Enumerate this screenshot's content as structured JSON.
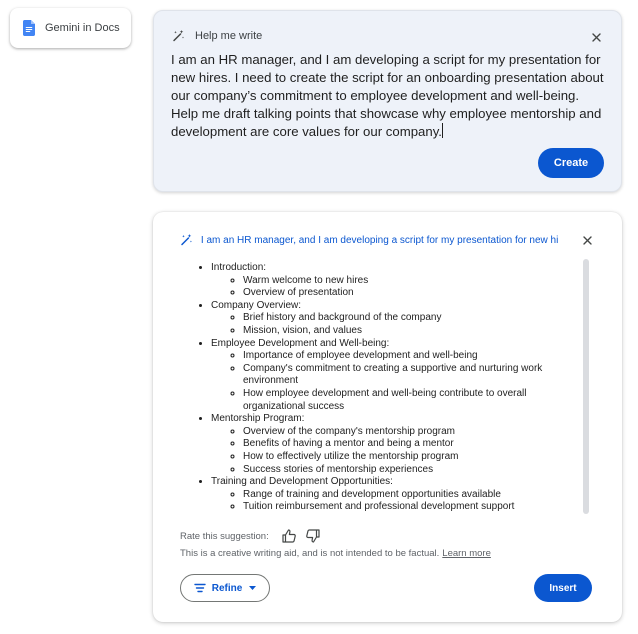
{
  "chip": {
    "icon": "google-docs-icon",
    "label": "Gemini in Docs"
  },
  "help_me_write": {
    "title": "Help me write",
    "prompt": "I am an HR manager, and I am developing a script for my presentation for new hires. I need to create the script for an onboarding presentation about our company’s commitment to employee development and well-being. Help me draft talking points that showcase why employee mentorship and development are core values for our company.",
    "create_label": "Create"
  },
  "result": {
    "prompt_preview": "I am an HR manager, and I am developing a script for my presentation for new hires",
    "outline": [
      {
        "label": "Introduction:",
        "children": [
          "Warm welcome to new hires",
          "Overview of presentation"
        ]
      },
      {
        "label": "Company Overview:",
        "children": [
          "Brief history and background of the company",
          "Mission, vision, and values"
        ]
      },
      {
        "label": "Employee Development and Well-being:",
        "children": [
          "Importance of employee development and well-being",
          "Company's commitment to creating a supportive and nurturing work environment",
          "How employee development and well-being contribute to overall organizational success"
        ]
      },
      {
        "label": "Mentorship Program:",
        "children": [
          "Overview of the company's mentorship program",
          "Benefits of having a mentor and being a mentor",
          "How to effectively utilize the mentorship program",
          "Success stories of mentorship experiences"
        ]
      },
      {
        "label": "Training and Development Opportunities:",
        "children": [
          "Range of training and development opportunities available",
          "Tuition reimbursement and professional development support"
        ]
      }
    ],
    "rate_label": "Rate this suggestion:",
    "disclaimer": "This is a creative writing aid, and is not intended to be factual.",
    "learn_more": "Learn more",
    "refine_label": "Refine",
    "insert_label": "Insert"
  },
  "colors": {
    "accent": "#0b57d0",
    "card_background": "#eef2f9"
  }
}
